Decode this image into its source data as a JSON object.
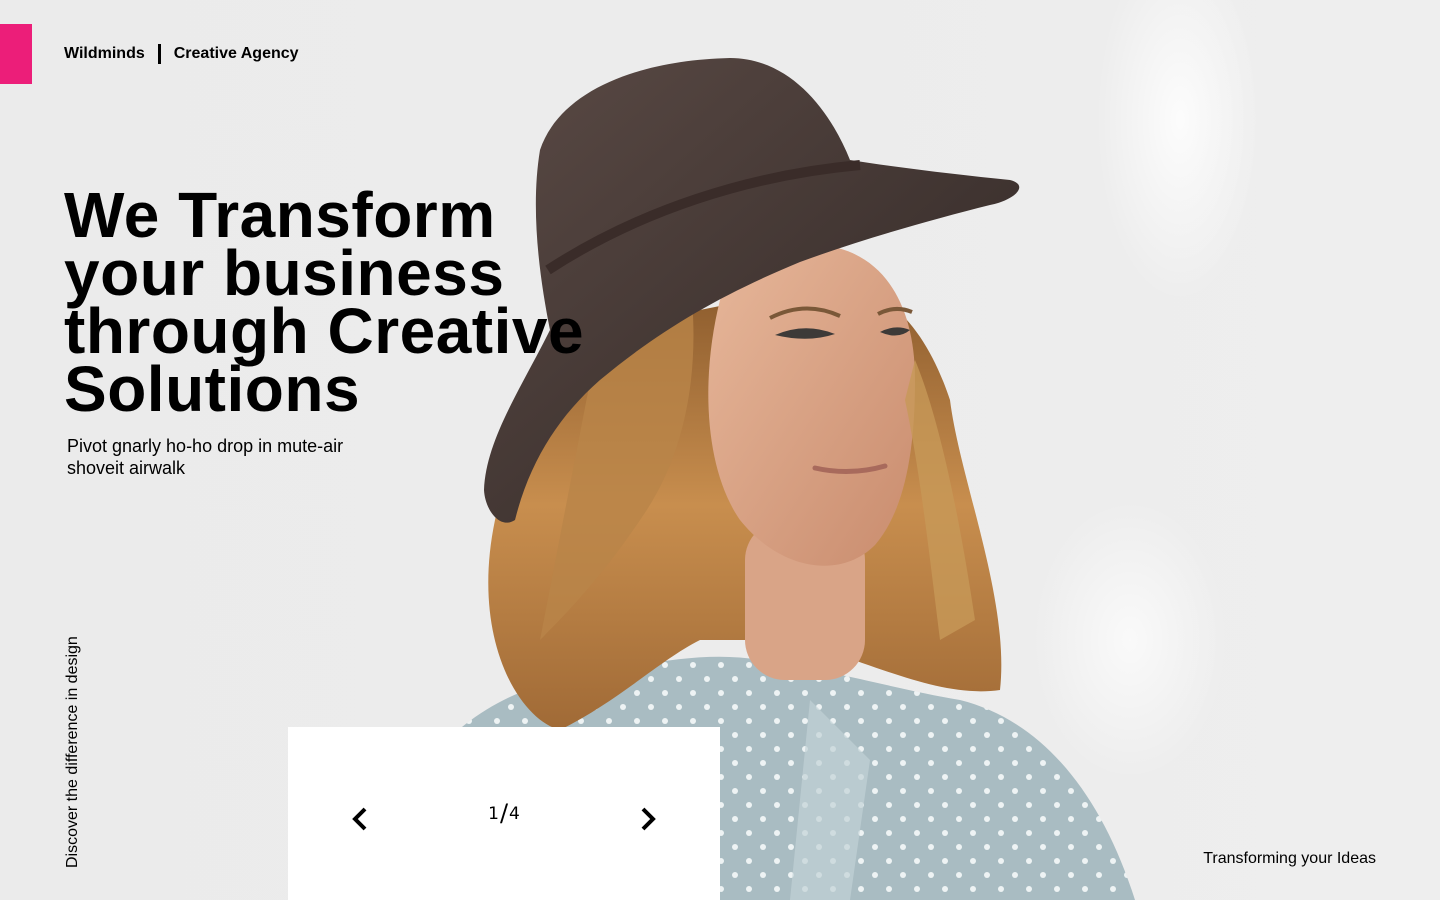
{
  "brand": {
    "name": "Wildminds",
    "tagline": "Creative Agency"
  },
  "hero": {
    "headline_lines": [
      "We Transform",
      "your business",
      "through Creative",
      "Solutions"
    ],
    "subtitle": "Pivot gnarly ho-ho drop in mute-air shoveit airwalk",
    "side_text": "Discover the difference in design",
    "bottom_right_text": "Transforming your Ideas"
  },
  "slider": {
    "current": "1",
    "separator": "/",
    "total": "4",
    "prev_icon": "chevron-left-icon",
    "next_icon": "chevron-right-icon"
  },
  "colors": {
    "accent": "#ec1e79",
    "background": "#ebebeb",
    "card": "#ffffff",
    "text": "#000000"
  }
}
